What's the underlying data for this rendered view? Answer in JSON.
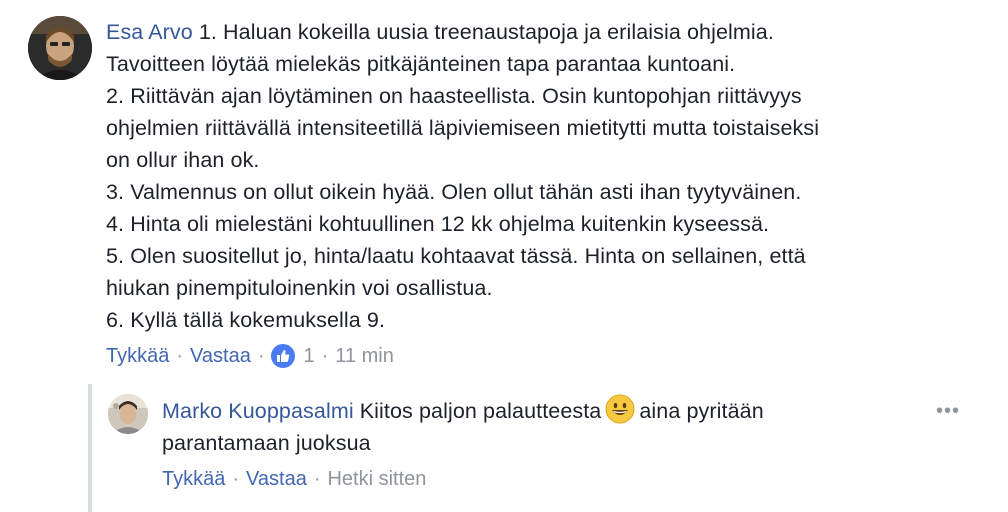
{
  "comment": {
    "author": "Esa Arvo",
    "lines": [
      "1. Haluan kokeilla uusia treenaustapoja ja erilaisia ohjelmia.",
      "Tavoitteen löytää mielekäs pitkäjänteinen tapa parantaa kuntoani.",
      "2. Riittävän ajan löytäminen on haasteellista. Osin kuntopohjan riittävyys",
      "ohjelmien riittävällä intensiteetillä läpiviemiseen mietitytti mutta toistaiseksi",
      "on ollur ihan ok.",
      "3. Valmennus on ollut oikein hyää. Olen ollut tähän asti ihan tyytyväinen.",
      "4. Hinta oli mielestäni kohtuullinen 12 kk ohjelma kuitenkin kyseessä.",
      "5. Olen suositellut jo, hinta/laatu kohtaavat tässä. Hinta on sellainen, että",
      "hiukan pinempituloinenkin voi osallistua.",
      "6. Kyllä tällä kokemuksella 9."
    ],
    "actions": {
      "like_label": "Tykkää",
      "reply_label": "Vastaa",
      "like_count": "1",
      "time": "11 min",
      "separator": "·"
    }
  },
  "reply": {
    "author": "Marko Kuoppasalmi",
    "text_before_emoji": "Kiitos paljon palautteesta",
    "emoji": "grinning-face",
    "text_after_emoji": "aina pyritään",
    "line2": "parantamaan juoksua",
    "more_label": "•••",
    "actions": {
      "like_label": "Tykkää",
      "reply_label": "Vastaa",
      "time": "Hetki sitten",
      "separator": "·"
    }
  },
  "colors": {
    "author": "#365899",
    "link": "#4267b2",
    "muted": "#90949c",
    "text": "#1d2129",
    "like_badge": "#4a7bf2",
    "thread_line": "#dadde1"
  }
}
